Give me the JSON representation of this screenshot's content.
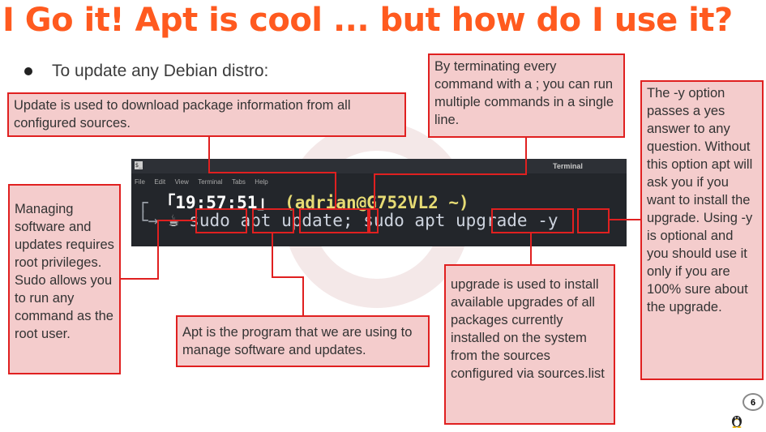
{
  "slide": {
    "title": "I Go it! Apt is cool ... but how do I use it?",
    "bullet": "To update any Debian distro:",
    "page_number": "6"
  },
  "terminal": {
    "window_title": "Terminal",
    "menu": [
      "File",
      "Edit",
      "View",
      "Terminal",
      "Tabs",
      "Help"
    ],
    "prompt_time": "19:57:51",
    "prompt_user_host": "(adrian@G752VL2 ~)",
    "command": {
      "sudo": "sudo",
      "apt": "apt",
      "update": "update;",
      "rest": " sudo apt ",
      "upgrade": "upgrade",
      "flag": "-y"
    }
  },
  "callouts": {
    "update": "Update is used to download package information from all configured sources.",
    "semicolon": "By terminating every command with a ; you can run multiple commands in a single line.",
    "yflag": "The -y option passes a yes answer to any question. Without this option apt will ask you if you want to install the upgrade. Using -y is optional and you should use it only if you are 100% sure about the upgrade.",
    "sudo": "Managing software and updates requires root privileges. Sudo allows you to run any command as the root user.",
    "apt": "Apt is the program that we are using to manage software and updates.",
    "upgrade": "upgrade is used to install available upgrades of all packages currently installed on the system from the sources configured via sources.list"
  }
}
